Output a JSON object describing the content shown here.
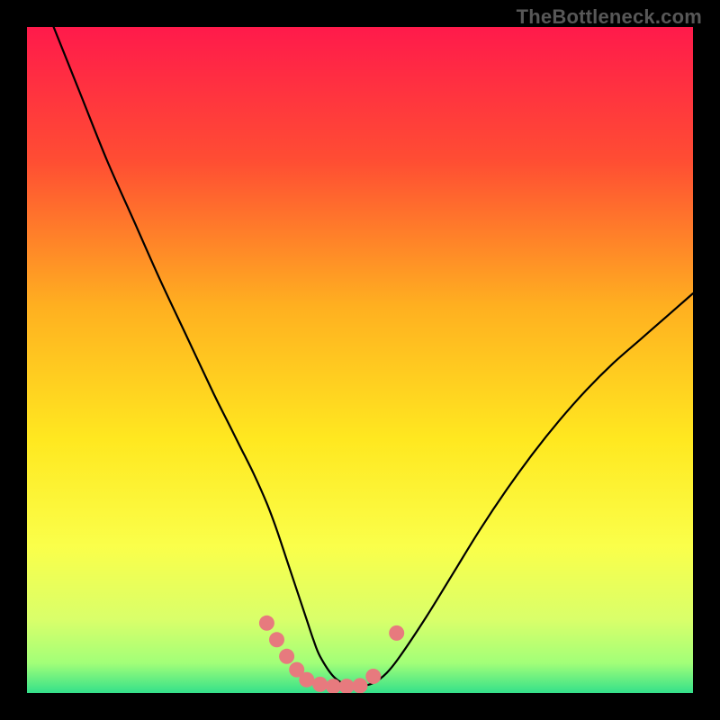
{
  "watermark": "TheBottleneck.com",
  "chart_data": {
    "type": "line",
    "title": "",
    "xlabel": "",
    "ylabel": "",
    "xlim": [
      0,
      100
    ],
    "ylim": [
      0,
      100
    ],
    "grid": false,
    "legend": false,
    "gradient_stops": [
      {
        "offset": 0.0,
        "color": "#ff1a4b"
      },
      {
        "offset": 0.2,
        "color": "#ff4d33"
      },
      {
        "offset": 0.42,
        "color": "#ffb020"
      },
      {
        "offset": 0.62,
        "color": "#ffe820"
      },
      {
        "offset": 0.78,
        "color": "#faff4a"
      },
      {
        "offset": 0.89,
        "color": "#d9ff6a"
      },
      {
        "offset": 0.955,
        "color": "#a2ff78"
      },
      {
        "offset": 1.0,
        "color": "#34e08a"
      }
    ],
    "series": [
      {
        "name": "curve",
        "color": "#000000",
        "width": 2.2,
        "x": [
          4,
          8,
          12,
          16,
          20,
          24,
          28,
          30,
          32,
          34,
          36,
          37.5,
          39,
          40.5,
          42,
          43,
          44,
          46,
          48,
          50,
          52,
          54,
          56,
          60,
          64,
          68,
          72,
          76,
          80,
          84,
          88,
          92,
          96,
          100
        ],
        "y": [
          100,
          90,
          80,
          71,
          62,
          53.5,
          45,
          41,
          37,
          33,
          28.5,
          24.5,
          20,
          15.5,
          11,
          8,
          5.5,
          2.5,
          1.2,
          1,
          1.5,
          3,
          5.5,
          11.5,
          18,
          24.5,
          30.5,
          36,
          41,
          45.5,
          49.5,
          53,
          56.5,
          60
        ]
      }
    ],
    "markers": {
      "color": "#e77a7e",
      "radius": 8.5,
      "points": [
        {
          "x": 36.0,
          "y": 10.5
        },
        {
          "x": 37.5,
          "y": 8.0
        },
        {
          "x": 39.0,
          "y": 5.5
        },
        {
          "x": 40.5,
          "y": 3.5
        },
        {
          "x": 42.0,
          "y": 2.0
        },
        {
          "x": 44.0,
          "y": 1.3
        },
        {
          "x": 46.0,
          "y": 1.0
        },
        {
          "x": 48.0,
          "y": 1.0
        },
        {
          "x": 50.0,
          "y": 1.1
        },
        {
          "x": 52.0,
          "y": 2.5
        },
        {
          "x": 55.5,
          "y": 9.0
        }
      ]
    }
  }
}
